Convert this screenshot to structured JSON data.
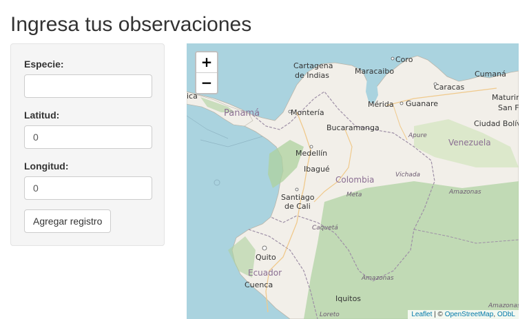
{
  "page": {
    "title": "Ingresa tus observaciones"
  },
  "form": {
    "species_label": "Especie:",
    "species_value": "",
    "latitude_label": "Latitud:",
    "latitude_value": "0",
    "longitude_label": "Longitud:",
    "longitude_value": "0",
    "submit_label": "Agregar registro"
  },
  "map": {
    "zoom_in": "+",
    "zoom_out": "−",
    "attribution": {
      "leaflet": "Leaflet",
      "separator": " | © ",
      "osm": "OpenStreetMap",
      "comma": ", ",
      "odbl": "ODbL"
    },
    "colors": {
      "water": "#aad3df",
      "land": "#f2efe9",
      "forest": "#add19e",
      "border": "#9e8fa6",
      "road": "#f0c98b"
    },
    "labels": [
      {
        "text": "Cartagena",
        "kind": "city"
      },
      {
        "text": "de Indias",
        "kind": "city"
      },
      {
        "text": "Maracaibo",
        "kind": "city"
      },
      {
        "text": "Coro",
        "kind": "city"
      },
      {
        "text": "Cumaná",
        "kind": "city"
      },
      {
        "text": "Caracas",
        "kind": "city"
      },
      {
        "text": "Maturin",
        "kind": "city"
      },
      {
        "text": "San Fe",
        "kind": "city"
      },
      {
        "text": "Ciudad Bolív",
        "kind": "city"
      },
      {
        "text": "Panamá",
        "kind": "country"
      },
      {
        "text": "Montería",
        "kind": "city"
      },
      {
        "text": "Mérida",
        "kind": "city"
      },
      {
        "text": "Guanare",
        "kind": "city"
      },
      {
        "text": "Bucaramanga",
        "kind": "city"
      },
      {
        "text": "Apure",
        "kind": "region"
      },
      {
        "text": "Venezuela",
        "kind": "country"
      },
      {
        "text": "Medellín",
        "kind": "city"
      },
      {
        "text": "Ibagué",
        "kind": "city"
      },
      {
        "text": "Colombia",
        "kind": "country"
      },
      {
        "text": "Vichada",
        "kind": "region"
      },
      {
        "text": "Meta",
        "kind": "region"
      },
      {
        "text": "Amazonas",
        "kind": "region"
      },
      {
        "text": "Santiago",
        "kind": "city"
      },
      {
        "text": "de Cali",
        "kind": "city"
      },
      {
        "text": "Caquetá",
        "kind": "region"
      },
      {
        "text": "Quito",
        "kind": "city"
      },
      {
        "text": "Ecuador",
        "kind": "country"
      },
      {
        "text": "Cuenca",
        "kind": "city"
      },
      {
        "text": "Amazonas",
        "kind": "region"
      },
      {
        "text": "Iquitos",
        "kind": "city"
      },
      {
        "text": "Amazonas",
        "kind": "region"
      },
      {
        "text": "Loreto",
        "kind": "region"
      },
      {
        "text": "ica",
        "kind": "city"
      }
    ]
  }
}
